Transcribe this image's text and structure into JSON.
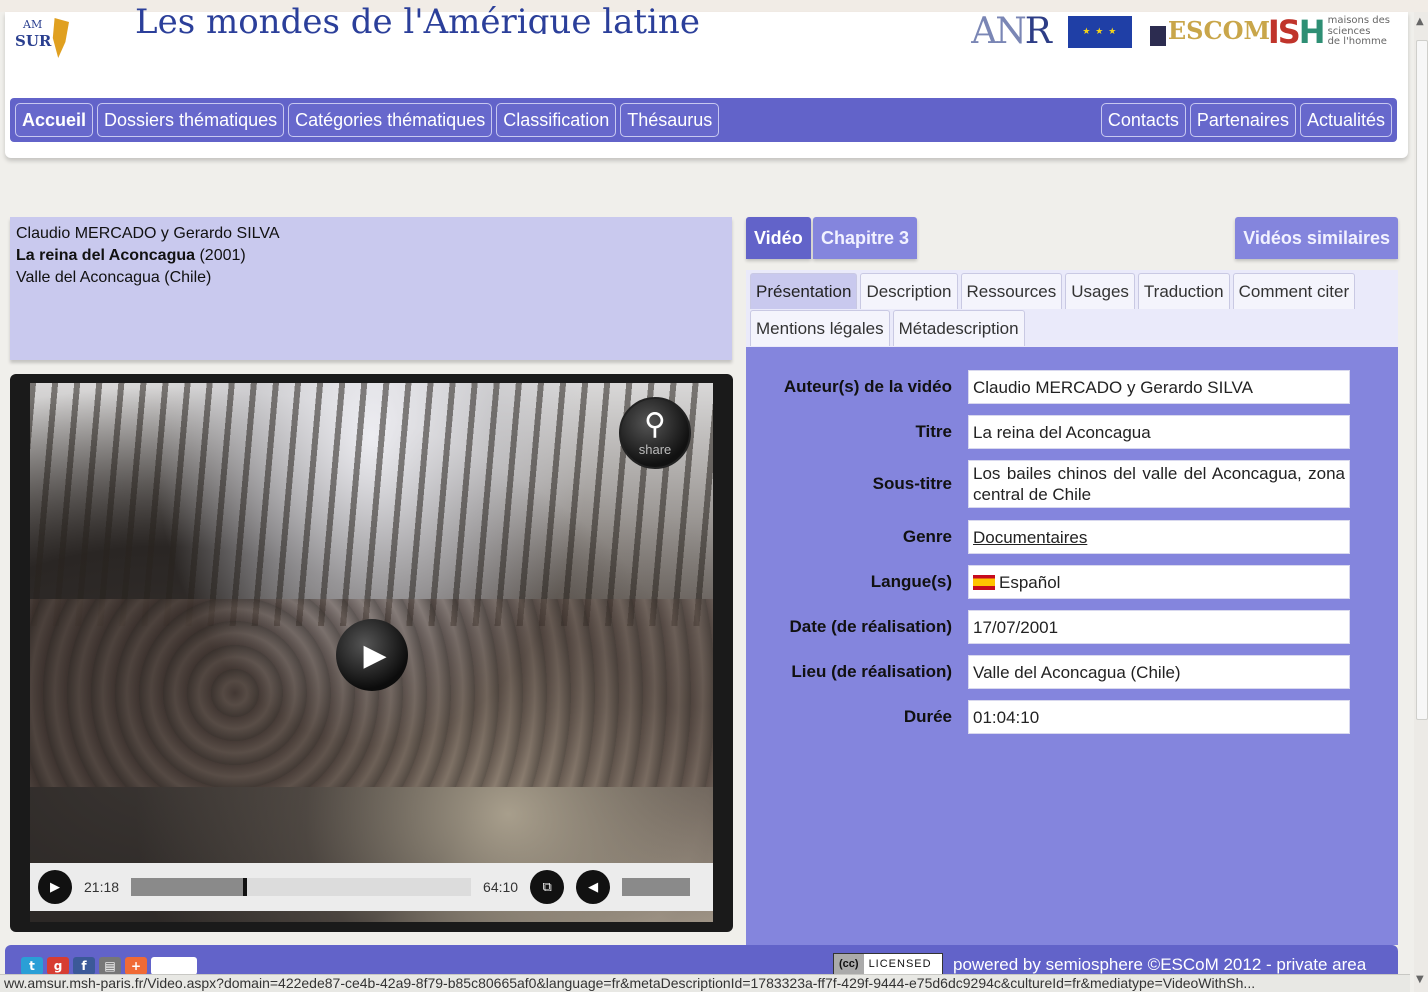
{
  "header": {
    "site_logo_am": "AM",
    "site_logo_sur": "SUR",
    "site_title": "Les mondes de l'Amérique latine",
    "sponsors": {
      "anr_a": "AN",
      "anr_r": "R",
      "escom": "ESCOM",
      "ish_big": "IS",
      "ish_h": "H",
      "ish_small_1": "maisons des",
      "ish_small_2": "sciences",
      "ish_small_3": "de l'homme"
    }
  },
  "nav": {
    "left": [
      "Accueil",
      "Dossiers thématiques",
      "Catégories thématiques",
      "Classification",
      "Thésaurus"
    ],
    "right": [
      "Contacts",
      "Partenaires",
      "Actualités"
    ]
  },
  "info": {
    "authors": "Claudio MERCADO y Gerardo SILVA",
    "title": "La reina del Aconcagua",
    "year": " (2001)",
    "place": "Valle del Aconcagua (Chile)"
  },
  "player": {
    "share_label": "share",
    "current_time": "21:18",
    "total_time": "64:10",
    "progress_fraction": 0.335
  },
  "tabs": {
    "video": "Vidéo",
    "chapter": "Chapitre 3",
    "similar": "Vidéos similaires"
  },
  "subtabs": {
    "row1": [
      "Présentation",
      "Description",
      "Ressources",
      "Usages",
      "Traduction",
      "Comment citer"
    ],
    "row2": [
      "Mentions légales",
      "Métadescription"
    ]
  },
  "details": {
    "authors_label": "Auteur(s) de la vidéo",
    "authors_value": "Claudio MERCADO y Gerardo SILVA",
    "title_label": "Titre",
    "title_value": "La reina del Aconcagua",
    "subtitle_label": "Sous-titre",
    "subtitle_value": "Los bailes chinos del valle del Aconcagua, zona central de Chile",
    "genre_label": "Genre",
    "genre_value": "Documentaires",
    "language_label": "Langue(s)",
    "language_value": "Español",
    "date_label": "Date (de réalisation)",
    "date_value": "17/07/2001",
    "place_label": "Lieu (de réalisation)",
    "place_value": "Valle del Aconcagua (Chile)",
    "duration_label": "Durée",
    "duration_value": "01:04:10"
  },
  "footer": {
    "cc_label": "(cc)",
    "licensed_label": "LICENSED",
    "powered_text": "powered by semiosphere ©ESCoM 2012 -  private area"
  },
  "statusbar": {
    "url": "ww.amsur.msh-paris.fr/Video.aspx?domain=422ede87-ce4b-42a9-8f79-b85c80665af0&language=fr&metaDescriptionId=1783323a-ff7f-429f-9444-e75d6dc9294c&cultureId=fr&mediatype=VideoWithSh..."
  },
  "colors": {
    "nav_blue": "#6263c9",
    "panel_lavender": "#8485dd",
    "info_lavender": "#c9c9ee"
  }
}
